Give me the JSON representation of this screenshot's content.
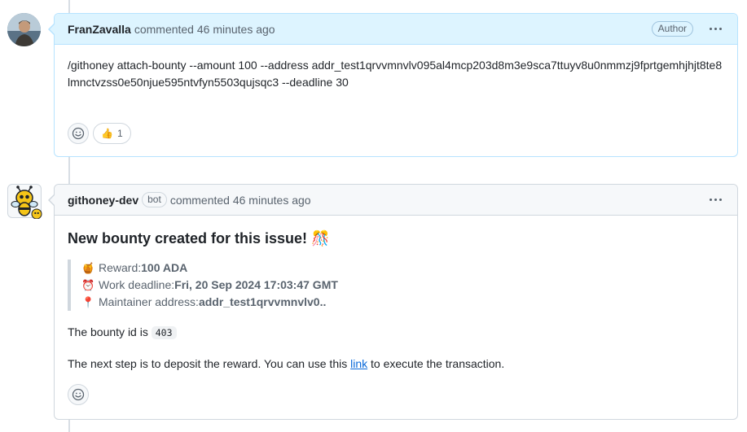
{
  "comments": [
    {
      "author": "FranZavalla",
      "meta": "commented 46 minutes ago",
      "role_badge": "Author",
      "body": "/githoney attach-bounty --amount 100 --address addr_test1qrvvmnvlv095al4mcp203d8m3e9sca7ttuyv8u0nmmzj9fprtgemhjhjt8te8lmnctvzss0e50njue595ntvfyn5503qujsqc3 --deadline 30",
      "reactions": [
        {
          "icon": "thumbs-up-icon",
          "emoji": "👍",
          "count": "1"
        }
      ]
    },
    {
      "author": "githoney-dev",
      "bot_badge": "bot",
      "meta": "commented 46 minutes ago",
      "heading": "New bounty created for this issue! 🎊",
      "quote": [
        {
          "icon": "honey-pot-icon",
          "emoji": "🍯",
          "label": "Reward: ",
          "value": "100 ADA"
        },
        {
          "icon": "alarm-clock-icon",
          "emoji": "⏰",
          "label": "Work deadline: ",
          "value": "Fri, 20 Sep 2024 17:03:47 GMT"
        },
        {
          "icon": "pin-icon",
          "emoji": "📍",
          "label": "Maintainer address: ",
          "value": "addr_test1qrvvmnvlv0.."
        }
      ],
      "bounty_id_text": "The bounty id is ",
      "bounty_id": "403",
      "next_step_before": "The next step is to deposit the reward. You can use this ",
      "next_step_link": "link",
      "next_step_after": " to execute the transaction."
    }
  ],
  "colors": {
    "author_header_bg": "#ddf4ff",
    "author_border": "#b6e3ff",
    "link": "#0969da"
  }
}
